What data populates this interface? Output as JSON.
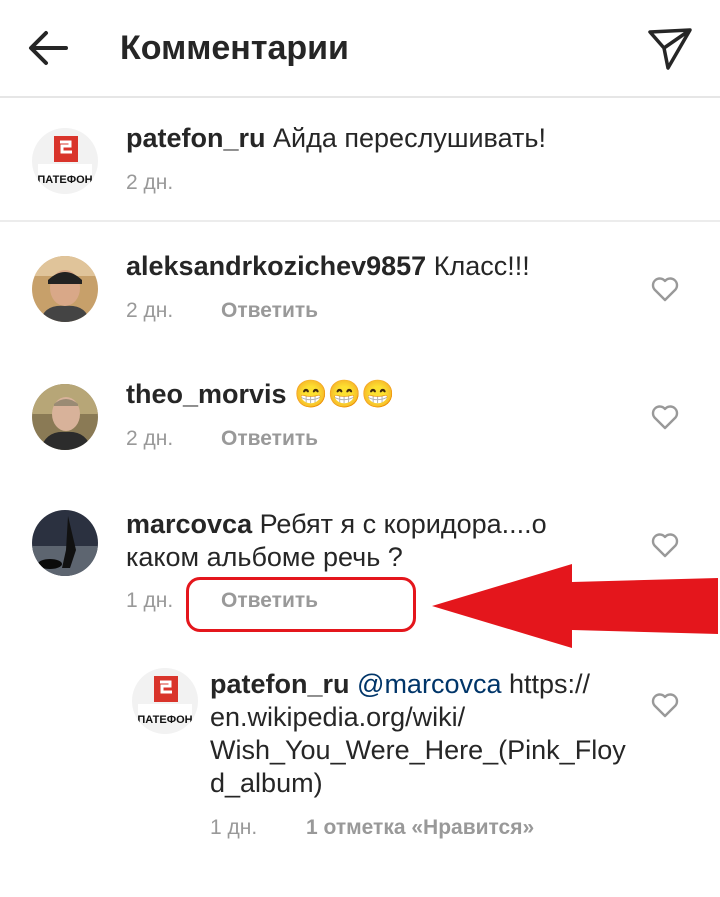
{
  "header": {
    "title": "Комментарии",
    "back_icon": "arrow-left-icon",
    "send_icon": "send-icon"
  },
  "comments": [
    {
      "user": "patefon_ru",
      "text": "Айда переслушивать!",
      "time": "2 дн.",
      "avatar_label": "ПАТЕФОН"
    },
    {
      "user": "aleksandrkozichev9857",
      "text": "Класс!!!",
      "time": "2 дн.",
      "reply": "Ответить"
    },
    {
      "user": "theo_morvis",
      "text": "😁😁😁",
      "time": "2 дн.",
      "reply": "Ответить"
    },
    {
      "user": "marcovca",
      "text_line1": "Ребят я с коридора....о",
      "text_line2": "каком альбоме речь ?",
      "time": "1 дн.",
      "reply": "Ответить"
    }
  ],
  "reply_comment": {
    "user": "patefon_ru",
    "mention": "@marcovca",
    "text_line1": "https://",
    "text_line2": "en.wikipedia.org/wiki/",
    "text_line3": "Wish_You_Were_Here_(Pink_Floy",
    "text_line4": "d_album)",
    "time": "1 дн.",
    "likes": "1 отметка «Нравится»",
    "avatar_label": "ПАТЕФОН"
  },
  "annotation": {
    "highlight_color": "#e4161c"
  },
  "colors": {
    "text": "#262626",
    "meta": "#999999",
    "mention": "#003569"
  }
}
